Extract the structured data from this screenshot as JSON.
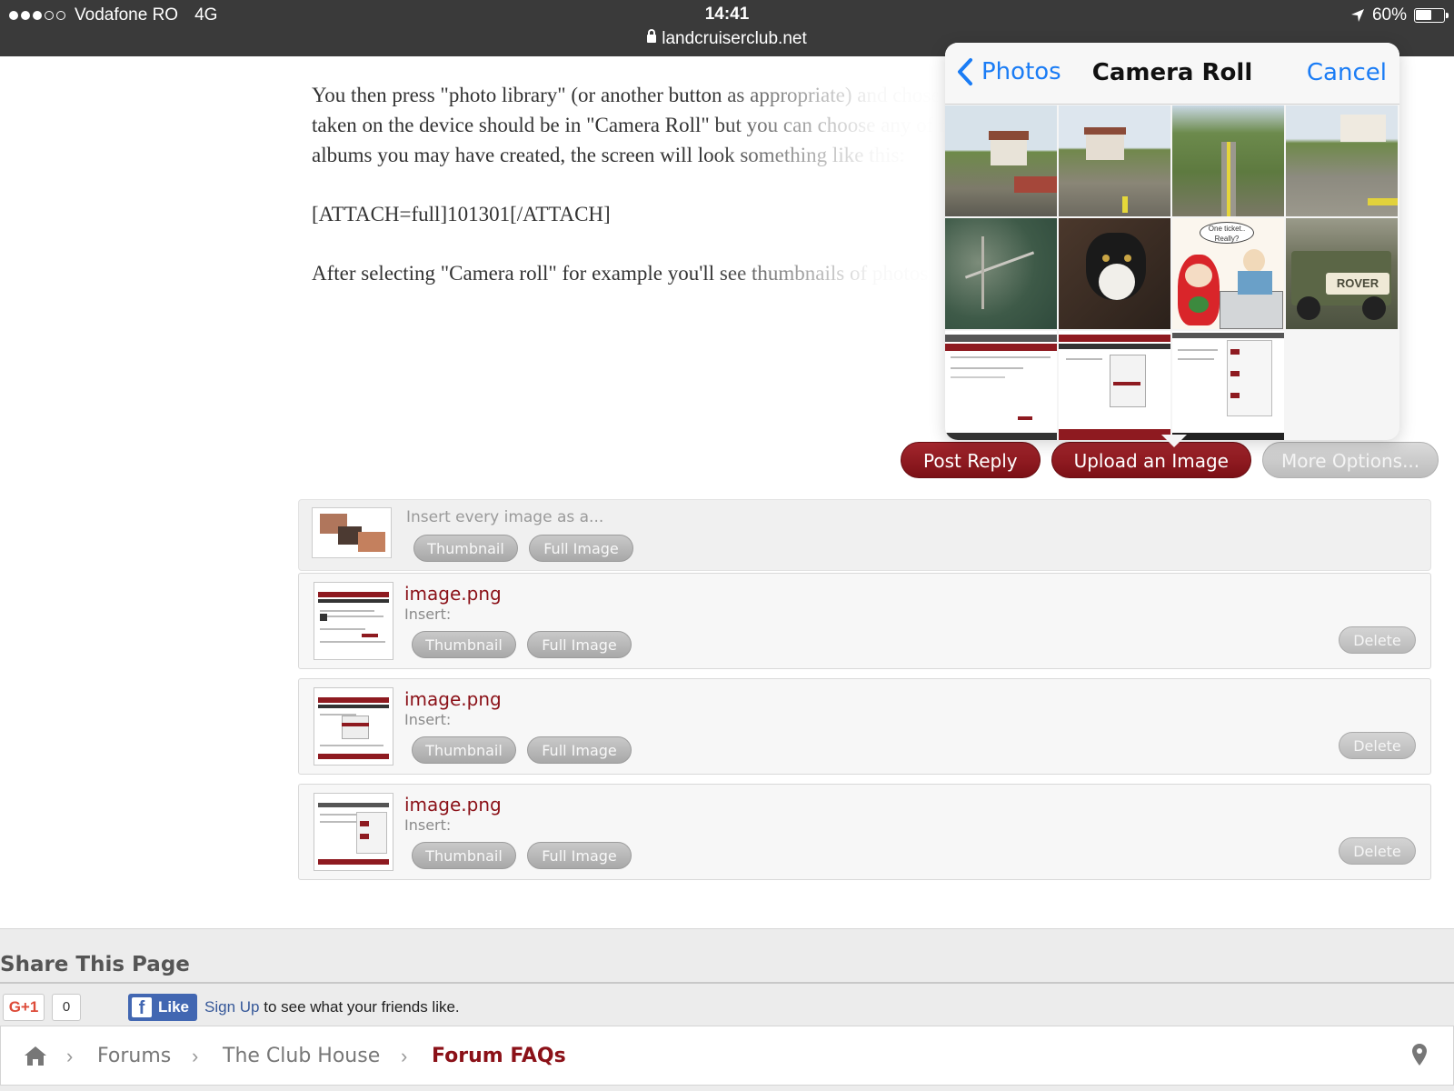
{
  "status_bar": {
    "carrier": "Vodafone RO",
    "network": "4G",
    "time": "14:41",
    "url": "landcruiserclub.net",
    "battery": "60%",
    "battery_level": 0.6,
    "signal_bars_filled": 3,
    "signal_bars_total": 5
  },
  "post": {
    "paragraphs": [
      "You then press \"photo library\" (or another button as appropriate) and chose the album you want to select photos from, photos",
      "taken on the device should be in \"Camera Roll\" but you can choose any of the",
      "albums you may have created, the screen will look something like this:",
      "[ATTACH=full]101301[/ATTACH]",
      "After selecting \"Camera roll\" for example you'll see thumbnails of photos"
    ]
  },
  "actions": {
    "post_reply": "Post Reply",
    "upload_image": "Upload an Image",
    "more_options": "More Options..."
  },
  "insert_all": {
    "label": "Insert every image as a...",
    "thumbnail": "Thumbnail",
    "full_image": "Full Image"
  },
  "attachments": [
    {
      "filename": "image.png",
      "insert_label": "Insert:",
      "thumbnail": "Thumbnail",
      "full_image": "Full Image",
      "delete": "Delete"
    },
    {
      "filename": "image.png",
      "insert_label": "Insert:",
      "thumbnail": "Thumbnail",
      "full_image": "Full Image",
      "delete": "Delete"
    },
    {
      "filename": "image.png",
      "insert_label": "Insert:",
      "thumbnail": "Thumbnail",
      "full_image": "Full Image",
      "delete": "Delete"
    }
  ],
  "picker": {
    "back_label": "Photos",
    "title": "Camera Roll",
    "cancel_label": "Cancel",
    "comic_caption": "One ticket.. Really?",
    "truck_text": "ROVER"
  },
  "share": {
    "title": "Share This Page",
    "gplus": "G+1",
    "gplus_count": "0",
    "fb_like": "Like",
    "fb_signup": "Sign Up",
    "fb_rest": "to see what your friends like."
  },
  "breadcrumb": {
    "items": [
      "Forums",
      "The Club House",
      "Forum FAQs"
    ],
    "home_icon": "home-icon",
    "pin_icon": "map-pin-icon"
  },
  "colors": {
    "brand_red": "#8b1118",
    "ios_blue": "#1a7cf5",
    "status_bar": "#3a3a3a"
  }
}
